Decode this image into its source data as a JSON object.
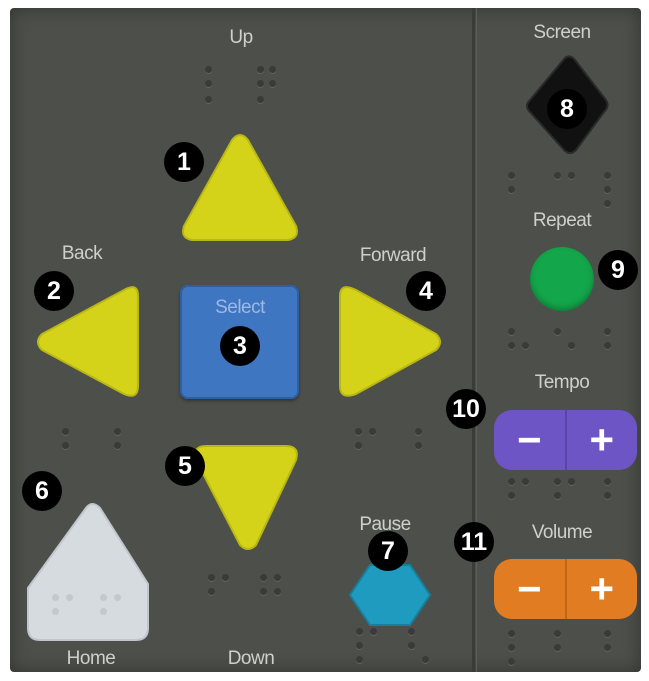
{
  "labels": {
    "up": "Up",
    "back": "Back",
    "forward": "Forward",
    "select": "Select",
    "down": "Down",
    "home": "Home",
    "pause": "Pause",
    "screen": "Screen",
    "repeat": "Repeat",
    "tempo": "Tempo",
    "volume": "Volume"
  },
  "callouts": [
    "1",
    "2",
    "3",
    "4",
    "5",
    "6",
    "7",
    "8",
    "9",
    "10",
    "11"
  ],
  "rockers": {
    "minus": "−",
    "plus": "+"
  },
  "colors": {
    "panel": "#4d4f4a",
    "arrow": "#d4d31a",
    "select": "#3f76c2",
    "home": "#d6dbe0",
    "pause": "#1f9bbf",
    "screen": "#111111",
    "repeat": "#13a64a",
    "tempo": "#6e55c5",
    "volume": "#e27c23",
    "callout": "#000000"
  },
  "icons": [
    "up-arrow-icon",
    "back-arrow-icon",
    "forward-arrow-icon",
    "down-arrow-icon",
    "home-icon",
    "pause-icon",
    "screen-icon"
  ]
}
